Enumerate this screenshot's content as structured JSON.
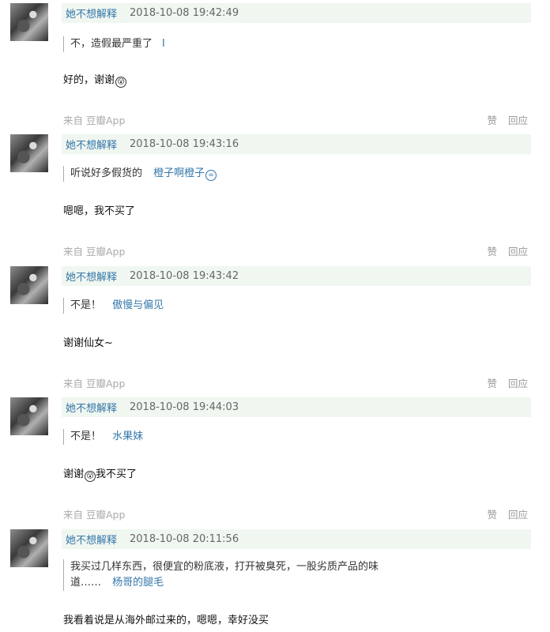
{
  "comments": [
    {
      "author": "她不想解释",
      "time": "2018-10-08 19:42:49",
      "quote_text": "不，造假最严重了",
      "quote_ref": "",
      "reply": "好的，谢谢"
    },
    {
      "author": "她不想解释",
      "time": "2018-10-08 19:43:16",
      "quote_text": "听说好多假货的",
      "quote_ref": "橙子啊橙子",
      "reply": "嗯嗯，我不买了"
    },
    {
      "author": "她不想解释",
      "time": "2018-10-08 19:43:42",
      "quote_text": "不是！",
      "quote_ref": "傲慢与偏见",
      "reply": "谢谢仙女~"
    },
    {
      "author": "她不想解释",
      "time": "2018-10-08 19:44:03",
      "quote_text": "不是！",
      "quote_ref": "水果妹",
      "reply": "谢谢",
      "reply_tail": "我不买了"
    },
    {
      "author": "她不想解释",
      "time": "2018-10-08 20:11:56",
      "quote_line1": "我买过几样东西，很便宜的粉底液，打开被臭死，一股劣质产品的味",
      "quote_line2": "道……",
      "quote_ref": "杨哥的腿毛",
      "reply": "我看着说是从海外邮过来的，嗯嗯，幸好没买"
    }
  ],
  "footer": {
    "source": "来自 豆瓣App",
    "like": "赞",
    "reply": "回应"
  }
}
